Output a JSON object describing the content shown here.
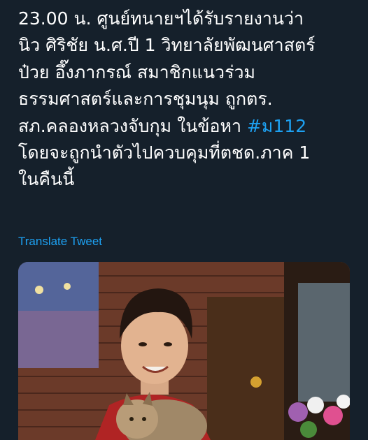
{
  "tweet": {
    "lines": [
      "23.00 น. ศูนย์ทนายฯได้รับรายงานว่า",
      "นิว ศิริชัย น.ศ.ปี 1 วิทยาลัยพัฒนศาสตร์",
      "ป๋วย อึ๊งภากรณ์ สมาชิกแนวร่วม",
      "ธรรมศาสตร์และการชุมนุม ถูกตร.",
      "สภ.คลองหลวงจับกุม  ในข้อหา ",
      "โดยจะถูกนำตัวไปควบคุมที่ตชด.ภาค 1",
      "ในคืนนี้"
    ],
    "hashtag": "#ม112",
    "translate_label": "Translate Tweet"
  },
  "colors": {
    "background": "#15202b",
    "text": "#ffffff",
    "link": "#1da1f2"
  },
  "media": {
    "description_icon": "photo-attachment"
  }
}
